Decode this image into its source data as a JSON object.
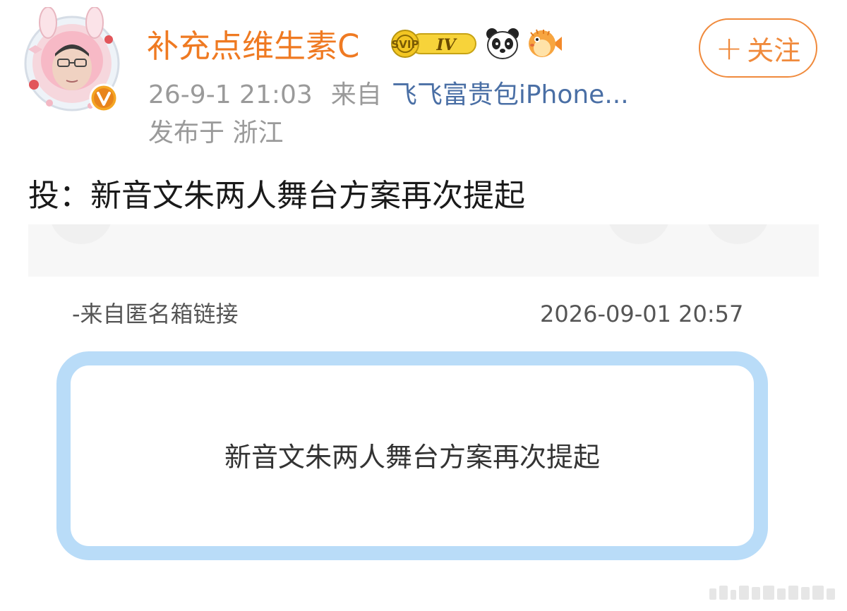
{
  "post": {
    "author": {
      "username": "补充点维生素C",
      "level_badge": "IV",
      "avatar_icon": "user-avatar",
      "verified_icon": "verified-v-icon",
      "emoji_icons": [
        "panda-emoji-icon",
        "puffer-fish-emoji-icon"
      ]
    },
    "follow_label": "关注",
    "follow_icon": "plus-icon",
    "timestamp": "26-9-1 21:03",
    "source_prefix": "来自",
    "source_device": "飞飞富贵包iPhone...",
    "location": "发布于 浙江",
    "text": "投：新音文朱两人舞台方案再次提起"
  },
  "shared_card": {
    "source": "-来自匿名箱链接",
    "time": "2026-09-01 20:57",
    "message": "新音文朱两人舞台方案再次提起"
  },
  "colors": {
    "username": "#ef7a22",
    "follow": "#f08a3c",
    "source_link": "#4a6fa5",
    "card_border": "#b9dcf8",
    "meta_gray": "#9a9a9a"
  }
}
